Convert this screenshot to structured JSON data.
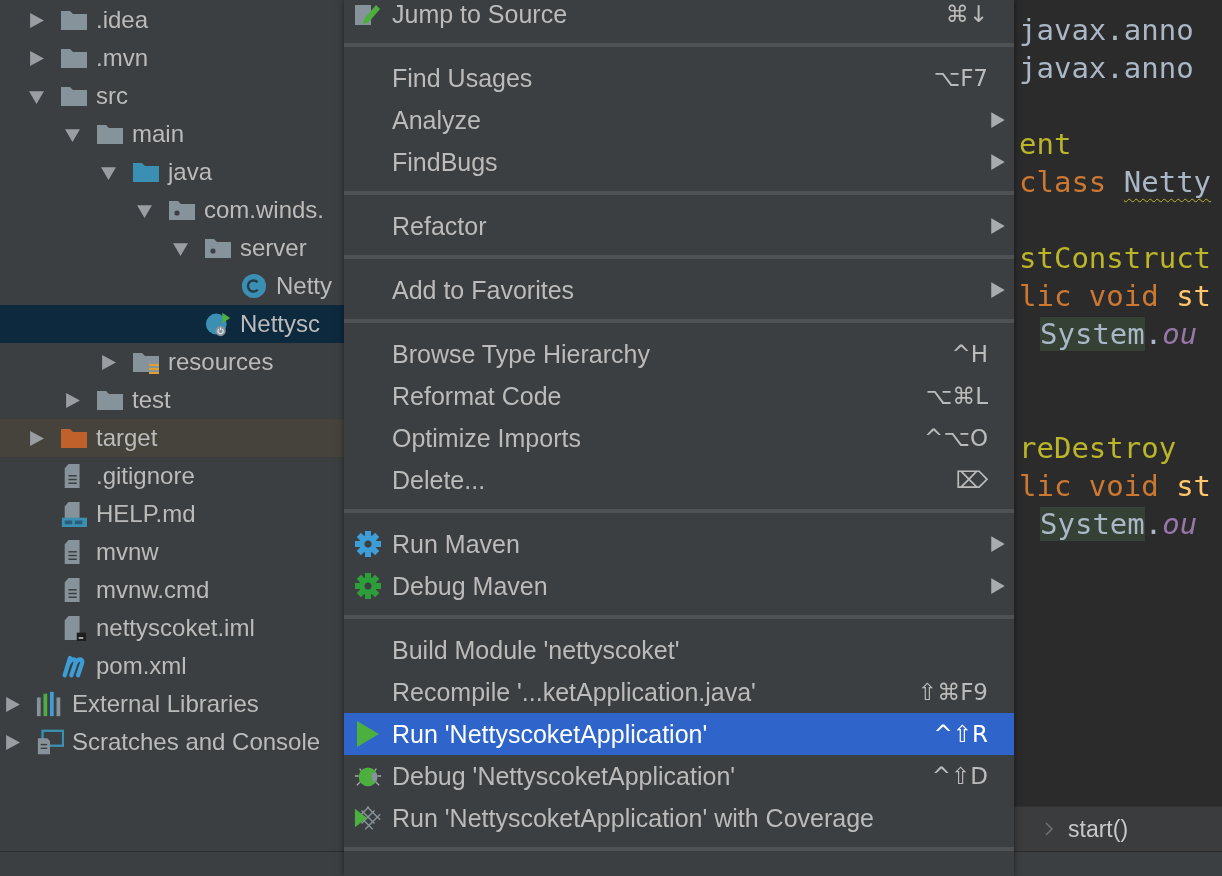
{
  "tree": {
    "project_items": [
      {
        "label": ".idea",
        "kind": "folder",
        "expanded": false,
        "selected": false
      },
      {
        "label": ".mvn",
        "kind": "folder",
        "expanded": false,
        "selected": false
      },
      {
        "label": "src",
        "kind": "folder",
        "expanded": true,
        "selected": false,
        "children": [
          {
            "label": "main",
            "kind": "folder",
            "expanded": true,
            "selected": false,
            "children": [
              {
                "label": "java",
                "kind": "source-folder",
                "expanded": true,
                "selected": false,
                "children": [
                  {
                    "label": "com.winds.",
                    "kind": "package",
                    "expanded": true,
                    "selected": false,
                    "children": [
                      {
                        "label": "server",
                        "kind": "package",
                        "expanded": true,
                        "selected": false,
                        "children": [
                          {
                            "label": "Netty",
                            "kind": "class",
                            "selected": false
                          }
                        ]
                      },
                      {
                        "label": "Nettysc",
                        "kind": "run-class",
                        "selected": true
                      }
                    ]
                  }
                ]
              },
              {
                "label": "resources",
                "kind": "resources-folder",
                "expanded": false,
                "selected": false
              }
            ]
          },
          {
            "label": "test",
            "kind": "folder",
            "expanded": false,
            "selected": false
          }
        ]
      },
      {
        "label": "target",
        "kind": "excluded-folder",
        "expanded": false,
        "selected": false
      },
      {
        "label": ".gitignore",
        "kind": "text-file",
        "selected": false
      },
      {
        "label": "HELP.md",
        "kind": "md-file",
        "selected": false
      },
      {
        "label": "mvnw",
        "kind": "text-file",
        "selected": false
      },
      {
        "label": "mvnw.cmd",
        "kind": "text-file",
        "selected": false
      },
      {
        "label": "nettyscoket.iml",
        "kind": "iml-file",
        "selected": false
      },
      {
        "label": "pom.xml",
        "kind": "pom-file",
        "selected": false
      }
    ],
    "top_level_items": [
      {
        "label": "External Libraries",
        "kind": "libraries",
        "expanded": false,
        "selected": false
      },
      {
        "label": "Scratches and Console",
        "kind": "scratches",
        "expanded": false,
        "selected": false
      }
    ]
  },
  "context_menu": {
    "groups": [
      {
        "items": [
          {
            "label": "Jump to Source",
            "shortcut": "⌘↓",
            "kind": "edit",
            "submenu": false,
            "selected": false
          }
        ]
      },
      {
        "items": [
          {
            "label": "Find Usages",
            "shortcut": "⌥F7",
            "kind": "plain",
            "submenu": false,
            "selected": false
          },
          {
            "label": "Analyze",
            "kind": "plain",
            "submenu": true,
            "selected": false
          },
          {
            "label": "FindBugs",
            "kind": "plain",
            "submenu": true,
            "selected": false
          }
        ]
      },
      {
        "items": [
          {
            "label": "Refactor",
            "kind": "plain",
            "submenu": true,
            "selected": false
          }
        ]
      },
      {
        "items": [
          {
            "label": "Add to Favorites",
            "kind": "plain",
            "submenu": true,
            "selected": false
          }
        ]
      },
      {
        "items": [
          {
            "label": "Browse Type Hierarchy",
            "shortcut": "^H",
            "kind": "plain",
            "submenu": false,
            "selected": false
          },
          {
            "label": "Reformat Code",
            "shortcut": "⌥⌘L",
            "kind": "plain",
            "submenu": false,
            "selected": false
          },
          {
            "label": "Optimize Imports",
            "shortcut": "^⌥O",
            "kind": "plain",
            "submenu": false,
            "selected": false
          },
          {
            "label": "Delete...",
            "shortcut": "⌦",
            "kind": "plain",
            "submenu": false,
            "selected": false
          }
        ]
      },
      {
        "items": [
          {
            "label": "Run Maven",
            "kind": "maven-run",
            "submenu": true,
            "selected": false
          },
          {
            "label": "Debug Maven",
            "kind": "maven-debug",
            "submenu": true,
            "selected": false
          }
        ]
      },
      {
        "items": [
          {
            "label": "Build Module 'nettyscoket'",
            "kind": "plain",
            "submenu": false,
            "selected": false
          },
          {
            "label": "Recompile '...ketApplication.java'",
            "shortcut": "⇧⌘F9",
            "kind": "plain",
            "submenu": false,
            "selected": false
          },
          {
            "label": "Run 'NettyscoketApplication'",
            "shortcut": "^⇧R",
            "kind": "run",
            "submenu": false,
            "selected": true
          },
          {
            "label": "Debug 'NettyscoketApplication'",
            "shortcut": "^⇧D",
            "kind": "debug",
            "submenu": false,
            "selected": false
          },
          {
            "label": "Run 'NettyscoketApplication' with Coverage",
            "kind": "coverage",
            "submenu": false,
            "selected": false
          }
        ]
      }
    ]
  },
  "editor": {
    "lines": [
      {
        "kind": "code",
        "words": [
          {
            "tokens": [
              {
                "kind": "plain",
                "text": "javax.anno"
              }
            ]
          }
        ]
      },
      {
        "kind": "code",
        "words": [
          {
            "tokens": [
              {
                "kind": "plain",
                "text": "javax.anno"
              }
            ]
          }
        ]
      },
      {
        "kind": "blank"
      },
      {
        "kind": "code",
        "words": [
          {
            "tokens": [
              {
                "kind": "annotation",
                "text": "ent"
              }
            ]
          }
        ]
      },
      {
        "kind": "code",
        "words": [
          {
            "tokens": [
              {
                "kind": "keyword",
                "text": "class"
              }
            ]
          },
          {
            "tokens": [
              {
                "kind": "warned-name",
                "text": "Netty"
              }
            ]
          }
        ]
      },
      {
        "kind": "blank"
      },
      {
        "kind": "code",
        "words": [
          {
            "tokens": [
              {
                "kind": "annotation",
                "text": "stConstruct"
              }
            ]
          }
        ]
      },
      {
        "kind": "code",
        "words": [
          {
            "tokens": [
              {
                "kind": "keyword",
                "text": "lic"
              }
            ]
          },
          {
            "tokens": [
              {
                "kind": "keyword",
                "text": "void"
              }
            ]
          },
          {
            "tokens": [
              {
                "kind": "method",
                "text": "st"
              }
            ]
          }
        ]
      },
      {
        "kind": "indented",
        "words": [
          {
            "tokens": [
              {
                "kind": "usage",
                "text": "System"
              },
              {
                "kind": "plain",
                "text": "."
              },
              {
                "kind": "field",
                "text": "ou"
              }
            ]
          }
        ]
      },
      {
        "kind": "blank"
      },
      {
        "kind": "blank"
      },
      {
        "kind": "code",
        "words": [
          {
            "tokens": [
              {
                "kind": "annotation",
                "text": "reDestroy"
              }
            ]
          }
        ]
      },
      {
        "kind": "code",
        "words": [
          {
            "tokens": [
              {
                "kind": "keyword",
                "text": "lic"
              }
            ]
          },
          {
            "tokens": [
              {
                "kind": "keyword",
                "text": "void"
              }
            ]
          },
          {
            "tokens": [
              {
                "kind": "method",
                "text": "st"
              }
            ]
          }
        ]
      },
      {
        "kind": "indented",
        "words": [
          {
            "tokens": [
              {
                "kind": "usage",
                "text": "System"
              },
              {
                "kind": "plain",
                "text": "."
              },
              {
                "kind": "field",
                "text": "ou"
              }
            ]
          }
        ]
      }
    ],
    "breadcrumb": [
      "start()"
    ]
  }
}
